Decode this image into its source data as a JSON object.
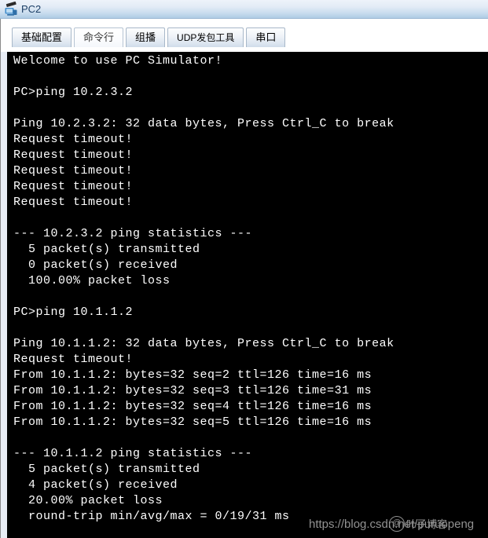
{
  "window": {
    "title": "PC2",
    "icon": "pc-monitor-icon"
  },
  "tabs": [
    {
      "label": "基础配置",
      "selected": false
    },
    {
      "label": "命令行",
      "selected": true
    },
    {
      "label": "组播",
      "selected": false
    },
    {
      "label": "UDP发包工具",
      "selected": false
    },
    {
      "label": "串口",
      "selected": false
    }
  ],
  "terminal": {
    "background_color": "#000000",
    "text_color": "#ffffff",
    "lines": [
      "Welcome to use PC Simulator!",
      "",
      "PC>ping 10.2.3.2",
      "",
      "Ping 10.2.3.2: 32 data bytes, Press Ctrl_C to break",
      "Request timeout!",
      "Request timeout!",
      "Request timeout!",
      "Request timeout!",
      "Request timeout!",
      "",
      "--- 10.2.3.2 ping statistics ---",
      "  5 packet(s) transmitted",
      "  0 packet(s) received",
      "  100.00% packet loss",
      "",
      "PC>ping 10.1.1.2",
      "",
      "Ping 10.1.1.2: 32 data bytes, Press Ctrl_C to break",
      "Request timeout!",
      "From 10.1.1.2: bytes=32 seq=2 ttl=126 time=16 ms",
      "From 10.1.1.2: bytes=32 seq=3 ttl=126 time=31 ms",
      "From 10.1.1.2: bytes=32 seq=4 ttl=126 time=16 ms",
      "From 10.1.1.2: bytes=32 seq=5 ttl=126 time=16 ms",
      "",
      "--- 10.1.1.2 ping statistics ---",
      "  5 packet(s) transmitted",
      "  4 packet(s) received",
      "  20.00% packet loss",
      "  round-trip min/avg/max = 0/19/31 ms"
    ]
  },
  "watermark": {
    "url": "https://blog.csdn.net/puruopeng",
    "badge": "@",
    "cn_text": "叶子博客"
  }
}
